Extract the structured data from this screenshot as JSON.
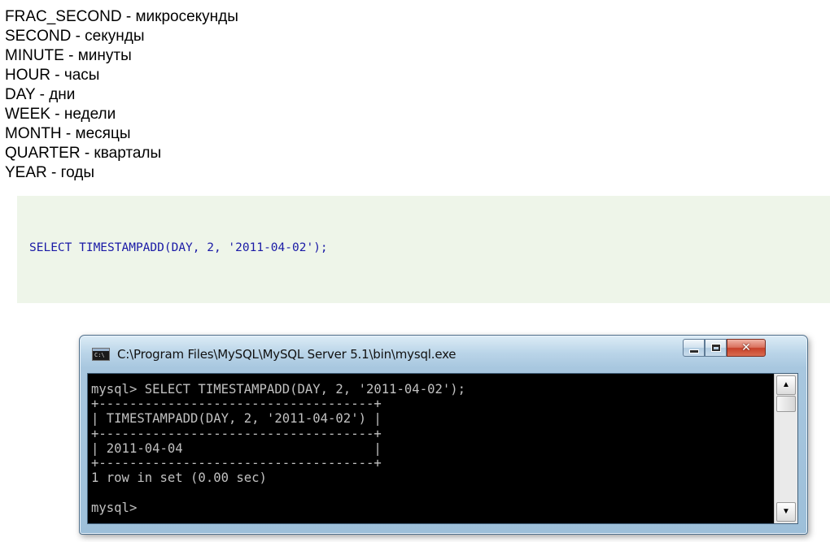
{
  "units": [
    "FRAC_SECOND - микросекунды",
    "SECOND - секунды",
    "MINUTE - минуты",
    "HOUR - часы",
    "DAY - дни",
    "WEEK - недели",
    "MONTH - месяцы",
    "QUARTER - кварталы",
    "YEAR - годы"
  ],
  "code": {
    "query": "SELECT TIMESTAMPADD(DAY, 2, '2011-04-02');"
  },
  "window": {
    "title": "C:\\Program Files\\MySQL\\MySQL Server 5.1\\bin\\mysql.exe",
    "icon": "console-window-icon",
    "icon_text": "C:\\",
    "controls": {
      "minimize": "minimize-icon",
      "maximize": "maximize-icon",
      "close": "close-icon"
    },
    "console_lines": [
      "mysql> SELECT TIMESTAMPADD(DAY, 2, '2011-04-02');",
      "+------------------------------------+",
      "| TIMESTAMPADD(DAY, 2, '2011-04-02') |",
      "+------------------------------------+",
      "| 2011-04-04                         |",
      "+------------------------------------+",
      "1 row in set (0.00 sec)",
      "",
      "mysql>"
    ],
    "scroll_up": "▲",
    "scroll_down": "▼"
  }
}
